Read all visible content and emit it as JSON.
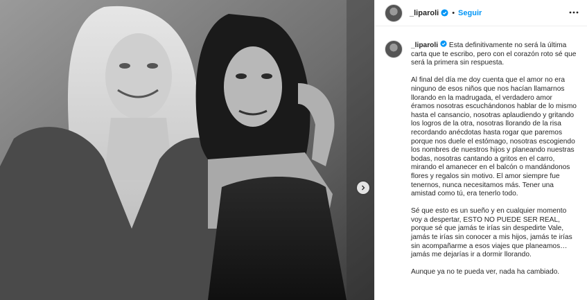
{
  "header": {
    "username": "_liparoli",
    "separator": "•",
    "follow_label": "Seguir"
  },
  "caption": {
    "username": "_liparoli",
    "paragraphs": [
      "Esta definitivamente no será la última carta que te escribo, pero con el corazón roto sé que será la primera sin respuesta.",
      "Al final del día me doy cuenta que el amor no era ninguno de esos niños que nos hacían llamarnos llorando en la madrugada, el verdadero amor éramos nosotras escuchándonos hablar de lo mismo hasta el cansancio, nosotras aplaudiendo y gritando los logros de la otra, nosotras llorando de la risa recordando anécdotas hasta rogar que paremos porque nos duele el estómago, nosotras escogiendo los nombres de nuestros hijos y planeando nuestras bodas, nosotras cantando a gritos en el carro, mirando el amanecer en el balcón o mandándonos flores y regalos sin motivo. El amor siempre fue tenernos, nunca necesitamos más. Tener una amistad como tú, era tenerlo todo.",
      "Sé que esto es un sueño y en cualquier momento voy a despertar, ESTO NO PUEDE SER REAL, porque sé que jamás te irías sin despedirte Vale, jamás te irías sin conocer a mis hijos, jamás te irías sin acompañarme a esos viajes que planeamos… jamás me dejarías ir a dormir llorando.",
      "Aunque ya no te pueda ver, nada ha cambiado."
    ]
  },
  "colors": {
    "accent": "#0095f6",
    "verified": "#0095f6",
    "text": "#262626"
  },
  "icons": {
    "verified": "verified-badge-icon",
    "more": "more-options-icon",
    "next": "chevron-right-icon"
  }
}
